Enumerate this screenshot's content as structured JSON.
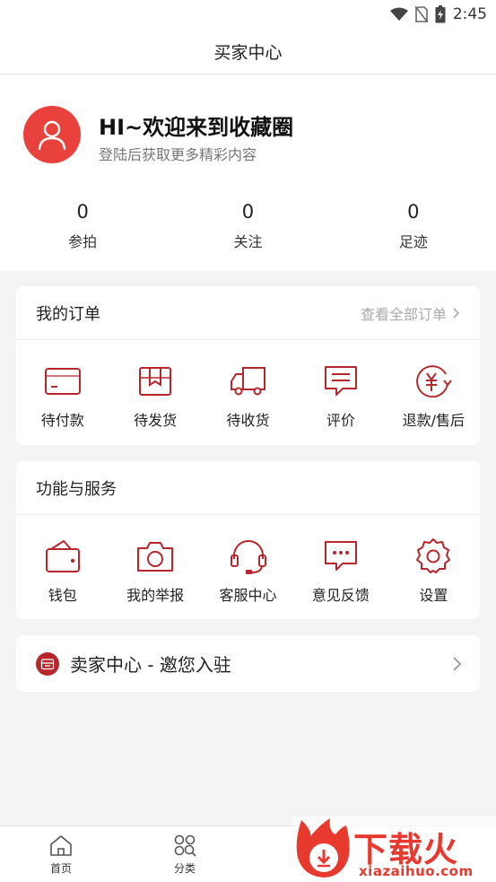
{
  "status_bar": {
    "time": "2:45"
  },
  "header": {
    "title": "买家中心"
  },
  "profile": {
    "greeting": "HI~欢迎来到收藏圈",
    "subtitle": "登陆后获取更多精彩内容",
    "stats": [
      {
        "value": "0",
        "label": "参拍"
      },
      {
        "value": "0",
        "label": "关注"
      },
      {
        "value": "0",
        "label": "足迹"
      }
    ]
  },
  "orders": {
    "title": "我的订单",
    "view_all": "查看全部订单",
    "items": [
      {
        "label": "待付款",
        "icon": "card-icon"
      },
      {
        "label": "待发货",
        "icon": "box-icon"
      },
      {
        "label": "待收货",
        "icon": "truck-icon"
      },
      {
        "label": "评价",
        "icon": "comment-icon"
      },
      {
        "label": "退款/售后",
        "icon": "refund-icon"
      }
    ]
  },
  "services": {
    "title": "功能与服务",
    "items": [
      {
        "label": "钱包",
        "icon": "wallet-icon"
      },
      {
        "label": "我的举报",
        "icon": "camera-icon"
      },
      {
        "label": "客服中心",
        "icon": "headset-icon"
      },
      {
        "label": "意见反馈",
        "icon": "feedback-icon"
      },
      {
        "label": "设置",
        "icon": "gear-icon"
      }
    ]
  },
  "seller": {
    "label": "卖家中心 - 邀您入驻"
  },
  "tabbar": {
    "items": [
      {
        "label": "首页",
        "icon": "home-icon"
      },
      {
        "label": "分类",
        "icon": "category-icon"
      }
    ]
  },
  "watermark": {
    "text": "下载火",
    "url": "xiazaihuo.com"
  },
  "colors": {
    "accent": "#b7262b",
    "avatar": "#e9423c",
    "background": "#f4f4f4"
  }
}
